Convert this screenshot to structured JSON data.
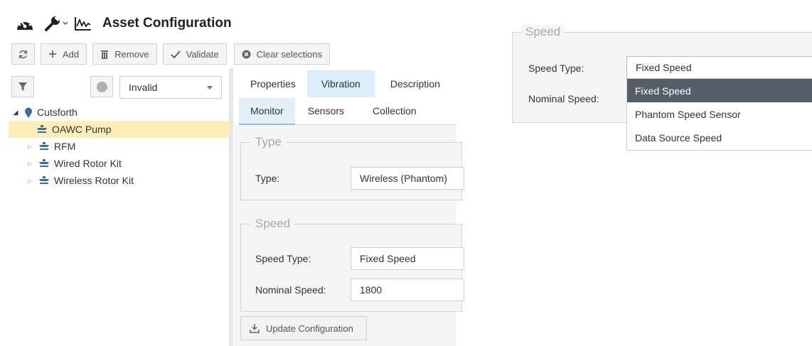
{
  "header": {
    "title": "Asset Configuration",
    "icons": [
      "dashboard-icon",
      "wrench-icon",
      "chevron-down-icon",
      "trend-chart-icon"
    ]
  },
  "toolbar": {
    "refresh_icon": "refresh-icon",
    "add_label": "Add",
    "remove_label": "Remove",
    "validate_label": "Validate",
    "clear_label": "Clear selections"
  },
  "filter": {
    "status_value": "Invalid"
  },
  "tree": {
    "root": "Cutsforth",
    "items": [
      {
        "label": "OAWC Pump",
        "selected": true,
        "expandable": false
      },
      {
        "label": "RFM",
        "selected": false,
        "expandable": true
      },
      {
        "label": "Wired Rotor Kit",
        "selected": false,
        "expandable": true
      },
      {
        "label": "Wireless Rotor Kit",
        "selected": false,
        "expandable": true
      }
    ]
  },
  "tabs": [
    {
      "label": "Properties",
      "active": false
    },
    {
      "label": "Vibration",
      "active": true
    },
    {
      "label": "Description",
      "active": false
    }
  ],
  "subtabs": [
    {
      "label": "Monitor",
      "active": true
    },
    {
      "label": "Sensors",
      "active": false
    },
    {
      "label": "Collection",
      "active": false
    }
  ],
  "type_section": {
    "legend": "Type",
    "type_label": "Type:",
    "type_value": "Wireless (Phantom)"
  },
  "speed_section": {
    "legend": "Speed",
    "speed_type_label": "Speed Type:",
    "speed_type_value": "Fixed Speed",
    "nominal_label": "Nominal Speed:",
    "nominal_value": "1800"
  },
  "update_button": "Update Configuration",
  "zoom": {
    "legend": "Speed",
    "speed_type_label": "Speed Type:",
    "nominal_label": "Nominal Speed:",
    "selected_value": "Fixed Speed",
    "options": [
      "Fixed Speed",
      "Phantom Speed Sensor",
      "Data Source Speed"
    ]
  },
  "colors": {
    "selected_row": "#fbeeb8",
    "active_tab": "#dbeefa",
    "dropdown_highlight": "#555d66",
    "node_icon": "#3b6f95"
  }
}
